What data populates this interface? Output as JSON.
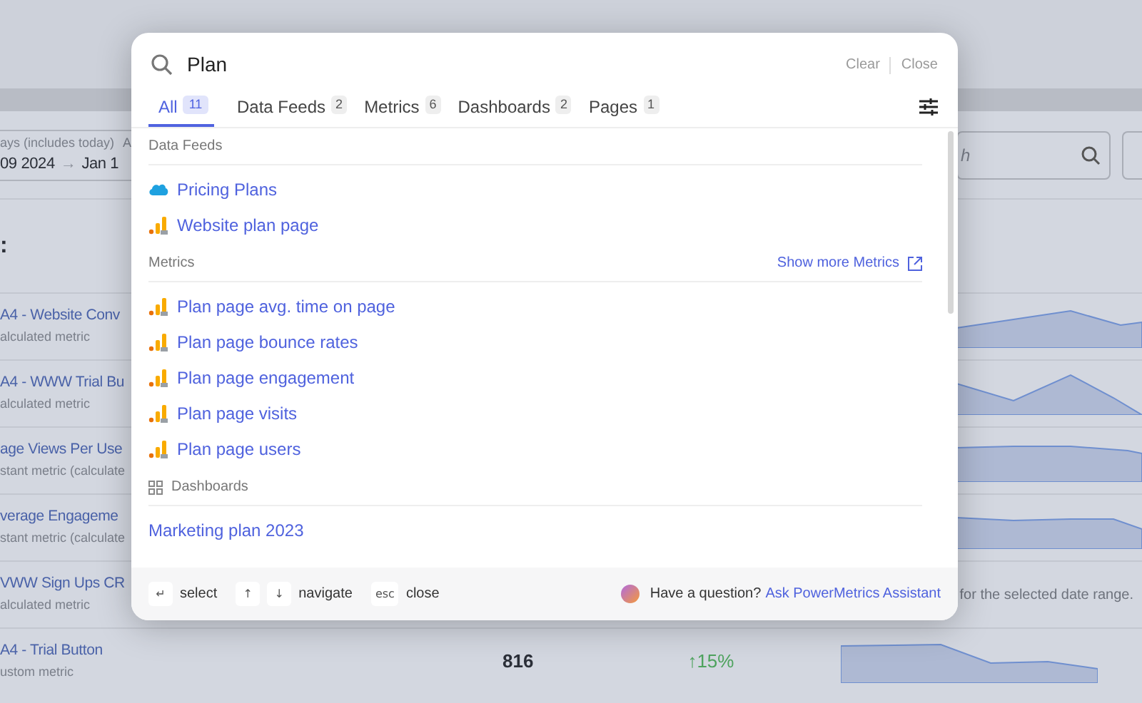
{
  "background": {
    "date_range": {
      "label": "ays (includes today)",
      "label_2": "A",
      "start": "09 2024",
      "arrow": "→",
      "end": "Jan 1"
    },
    "heading": ":",
    "search": {
      "placeholder": "h"
    },
    "rows": [
      {
        "name": "A4 - Website Conv",
        "type": "alculated metric"
      },
      {
        "name": "A4 - WWW Trial Bu",
        "type": "alculated metric"
      },
      {
        "name": "age Views Per Use",
        "type": "stant metric (calculate"
      },
      {
        "name": "verage Engageme",
        "type": "stant metric (calculate"
      },
      {
        "name": "VWW Sign Ups CR",
        "type": "alculated metric",
        "note": "for the selected date range."
      },
      {
        "name": "A4 - Trial Button",
        "type": "ustom metric",
        "value": "816",
        "change": "↑15%"
      }
    ]
  },
  "search_modal": {
    "query": "Plan",
    "clear": "Clear",
    "close": "Close",
    "tabs": [
      {
        "label": "All",
        "count": "11",
        "selected": true
      },
      {
        "label": "Data Feeds",
        "count": "2",
        "selected": false
      },
      {
        "label": "Metrics",
        "count": "6",
        "selected": false
      },
      {
        "label": "Dashboards",
        "count": "2",
        "selected": false
      },
      {
        "label": "Pages",
        "count": "1",
        "selected": false
      }
    ],
    "sections": [
      {
        "title": "Data Feeds",
        "items": [
          {
            "label": "Pricing Plans",
            "kind": "cloud"
          },
          {
            "label": "Website plan page",
            "kind": "chart"
          }
        ]
      },
      {
        "title": "Metrics",
        "action": "Show more Metrics",
        "items": [
          {
            "label": "Plan page avg. time on page",
            "kind": "chart"
          },
          {
            "label": "Plan page bounce rates",
            "kind": "chart"
          },
          {
            "label": "Plan page engagement",
            "kind": "chart"
          },
          {
            "label": "Plan page visits",
            "kind": "chart"
          },
          {
            "label": "Plan page users",
            "kind": "chart"
          }
        ]
      },
      {
        "title": "Dashboards",
        "kind": "grid",
        "items": [
          {
            "label": "Marketing plan 2023",
            "kind": "plain"
          }
        ]
      }
    ],
    "footer": {
      "hints": [
        {
          "keys": [
            "↵"
          ],
          "label": "select"
        },
        {
          "keys": [
            "↑",
            "↓"
          ],
          "label": "navigate"
        },
        {
          "keys": [
            "esc"
          ],
          "label": "close"
        }
      ],
      "question": "Have a question?",
      "link": "Ask PowerMetrics Assistant"
    }
  }
}
